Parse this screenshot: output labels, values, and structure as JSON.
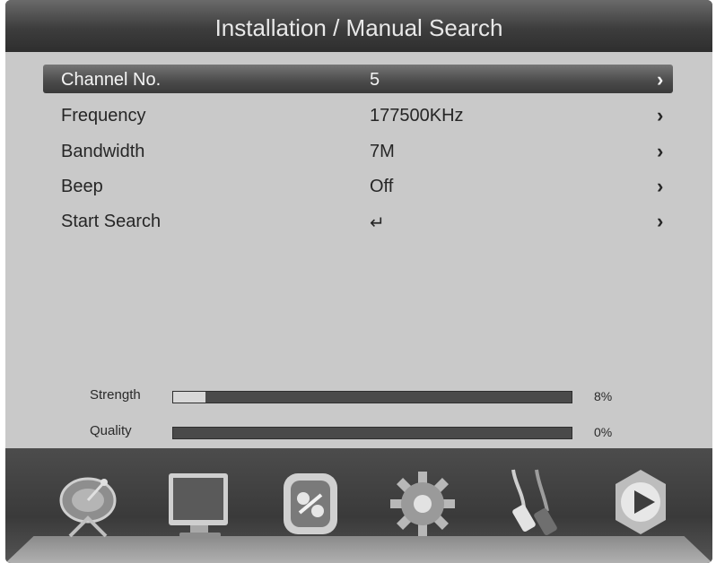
{
  "header": {
    "title": "Installation / Manual Search"
  },
  "menu": {
    "items": [
      {
        "label": "Channel No.",
        "value": "5",
        "arrow": "›",
        "selected": true
      },
      {
        "label": "Frequency",
        "value": "177500KHz",
        "arrow": "›"
      },
      {
        "label": "Bandwidth",
        "value": "7M",
        "arrow": "›"
      },
      {
        "label": "Beep",
        "value": "Off",
        "arrow": "›"
      },
      {
        "label": "Start Search",
        "value": "↵",
        "arrow": "›"
      }
    ]
  },
  "signal": {
    "strength": {
      "label": "Strength",
      "value_text": "8%",
      "fraction": 0.08
    },
    "quality": {
      "label": "Quality",
      "value_text": "0%",
      "fraction": 0.0
    }
  },
  "dock": {
    "icons": [
      "satellite-dish-icon",
      "tv-monitor-icon",
      "media-tools-icon",
      "gear-icon",
      "av-cable-icon",
      "play-icon"
    ]
  },
  "colors": {
    "panel": "#c9c9c9",
    "header": "#3d3d3d",
    "selected_row": "#4a4a4a",
    "bar_track": "#4a4a4a",
    "bar_fill": "#d8d8d8"
  }
}
